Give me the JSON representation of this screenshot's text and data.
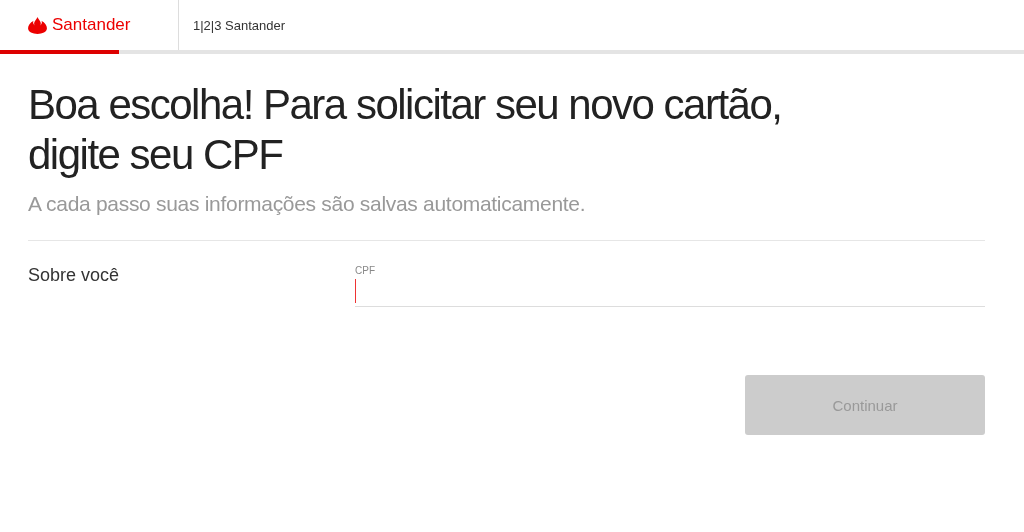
{
  "header": {
    "logo": "Santander",
    "title": "1|2|3 Santander",
    "progress": {
      "level": 0.116
    }
  },
  "heading": "Boa escolha! Para solicitar seu novo cartão, digite seu CPF",
  "subtitle": "A cada passo suas informações são salvas automaticamente.",
  "section": {
    "label": "Sobre você",
    "field": {
      "label": "CPF",
      "focused": true
    }
  },
  "button": {
    "label": "Continuar",
    "disabled": true
  }
}
